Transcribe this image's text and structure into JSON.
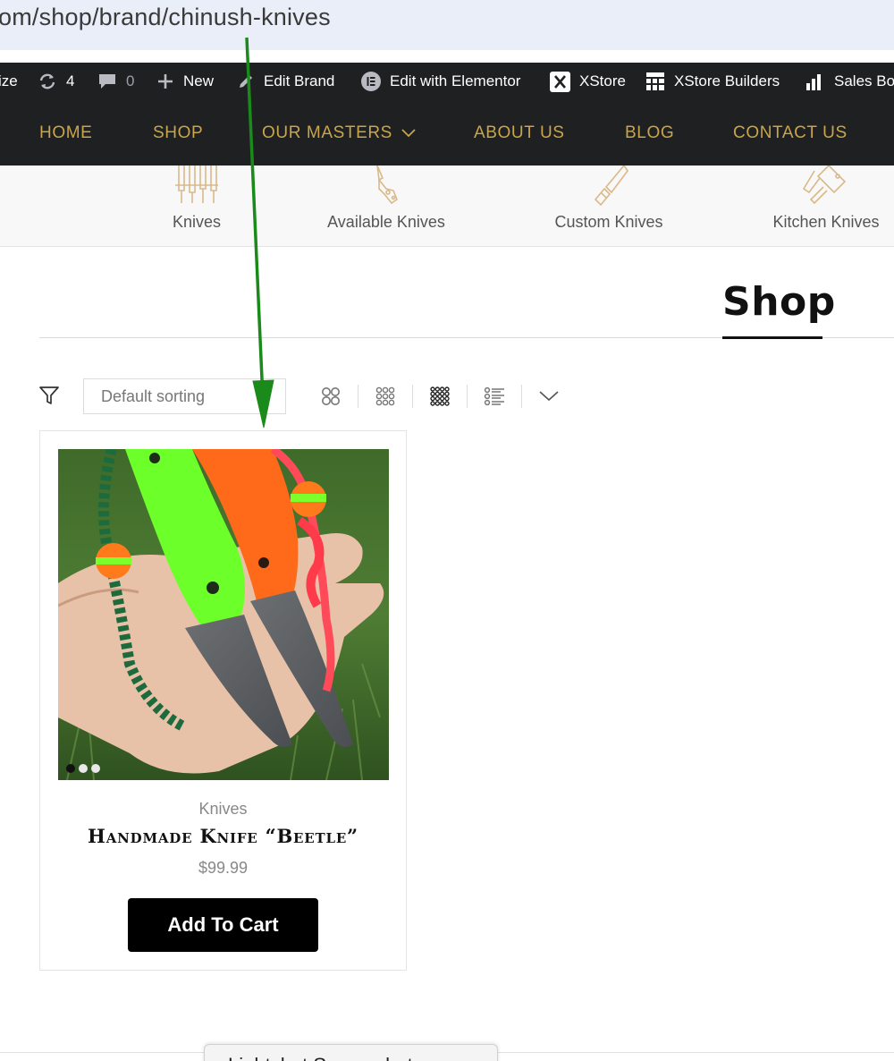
{
  "browser": {
    "url": "om/shop/brand/chinush-knives"
  },
  "admin_bar": {
    "customize_partial": "ize",
    "updates_count": "4",
    "comments_count": "0",
    "new_label": "New",
    "edit_brand_label": "Edit Brand",
    "elementor_label": "Edit with Elementor",
    "xstore_label": "XStore",
    "xstore_builders_label": "XStore Builders",
    "sales_booster_partial": "Sales Bo"
  },
  "nav": {
    "items": [
      {
        "label": "HOME"
      },
      {
        "label": "SHOP"
      },
      {
        "label": "OUR MASTERS",
        "has_dropdown": true
      },
      {
        "label": "ABOUT US"
      },
      {
        "label": "BLOG"
      },
      {
        "label": "CONTACT US"
      }
    ],
    "color": "#c9a54b"
  },
  "categories": [
    {
      "label": "Knives",
      "icon": "knives-set-icon"
    },
    {
      "label": "Available Knives",
      "icon": "folding-knife-icon"
    },
    {
      "label": "Custom Knives",
      "icon": "custom-blade-icon"
    },
    {
      "label": "Kitchen Knives",
      "icon": "kitchen-cleaver-icon"
    }
  ],
  "page": {
    "title": "Shop"
  },
  "toolbar": {
    "sort_placeholder": "Default sorting",
    "views": [
      "grid-2-icon",
      "grid-3-icon",
      "grid-4-icon",
      "list-icon"
    ],
    "active_view": "grid-4-icon"
  },
  "products": [
    {
      "category": "Knives",
      "title": "Handmade Knife “Beetle”",
      "price": "$99.99",
      "button": "Add To Cart",
      "gallery_dots": 3,
      "active_dot": 0
    }
  ],
  "popup": {
    "text": "Lightshot Screenshot"
  },
  "annotation": {
    "arrow_color": "#1a8a1a"
  }
}
